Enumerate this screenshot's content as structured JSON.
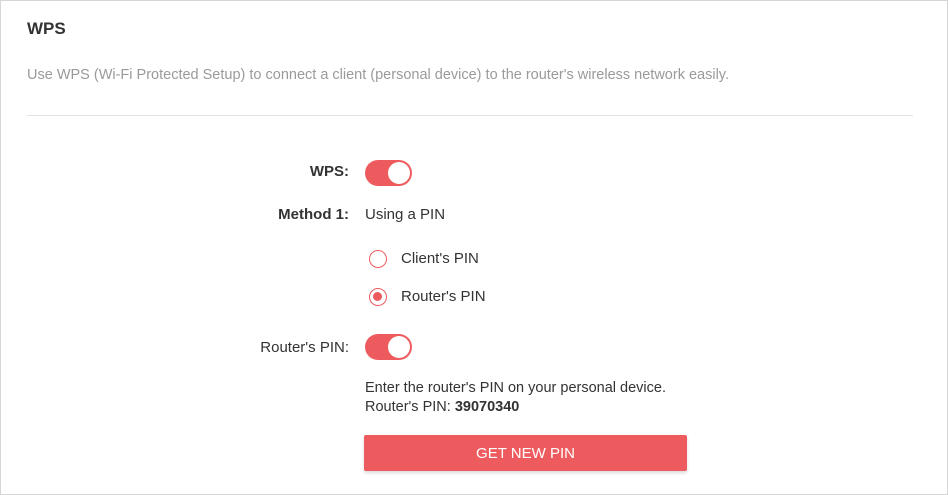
{
  "section": {
    "title": "WPS",
    "description": "Use WPS (Wi-Fi Protected Setup) to connect a client (personal device) to the router's wireless network easily."
  },
  "wps": {
    "label": "WPS:",
    "enabled": true
  },
  "method": {
    "label": "Method 1:",
    "value": "Using a PIN",
    "options": [
      {
        "label": "Client's PIN",
        "checked": false
      },
      {
        "label": "Router's PIN",
        "checked": true
      }
    ]
  },
  "router_pin": {
    "label": "Router's PIN:",
    "enabled": true,
    "instruction": "Enter the router's PIN on your personal device.",
    "pin_prefix": "Router's PIN:",
    "pin_value": "39070340",
    "button_label": "GET NEW PIN"
  },
  "colors": {
    "accent": "#ee5b5f",
    "text": "#333333",
    "muted": "#9a9a9a"
  }
}
